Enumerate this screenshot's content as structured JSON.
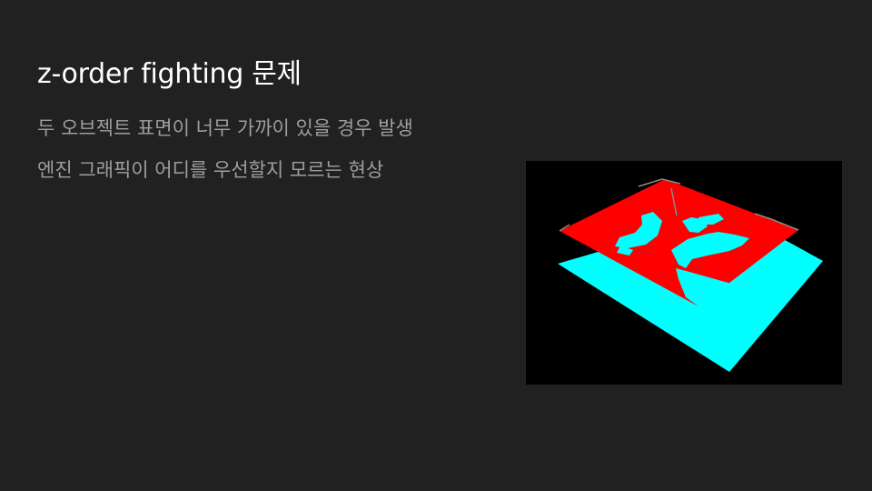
{
  "slide": {
    "title": "z-order fighting 문제",
    "bullets": [
      "두 오브젝트 표면이 너무 가까이 있을 경우 발생",
      "엔진 그래픽이 어디를 우선할지 모르는 현상"
    ]
  },
  "colors": {
    "background": "#212121",
    "title": "#ffffff",
    "bullet_text": "#9e9e9e",
    "figure_background": "#000000",
    "plane_bottom": "#00ffff",
    "plane_top": "#ff0000"
  }
}
